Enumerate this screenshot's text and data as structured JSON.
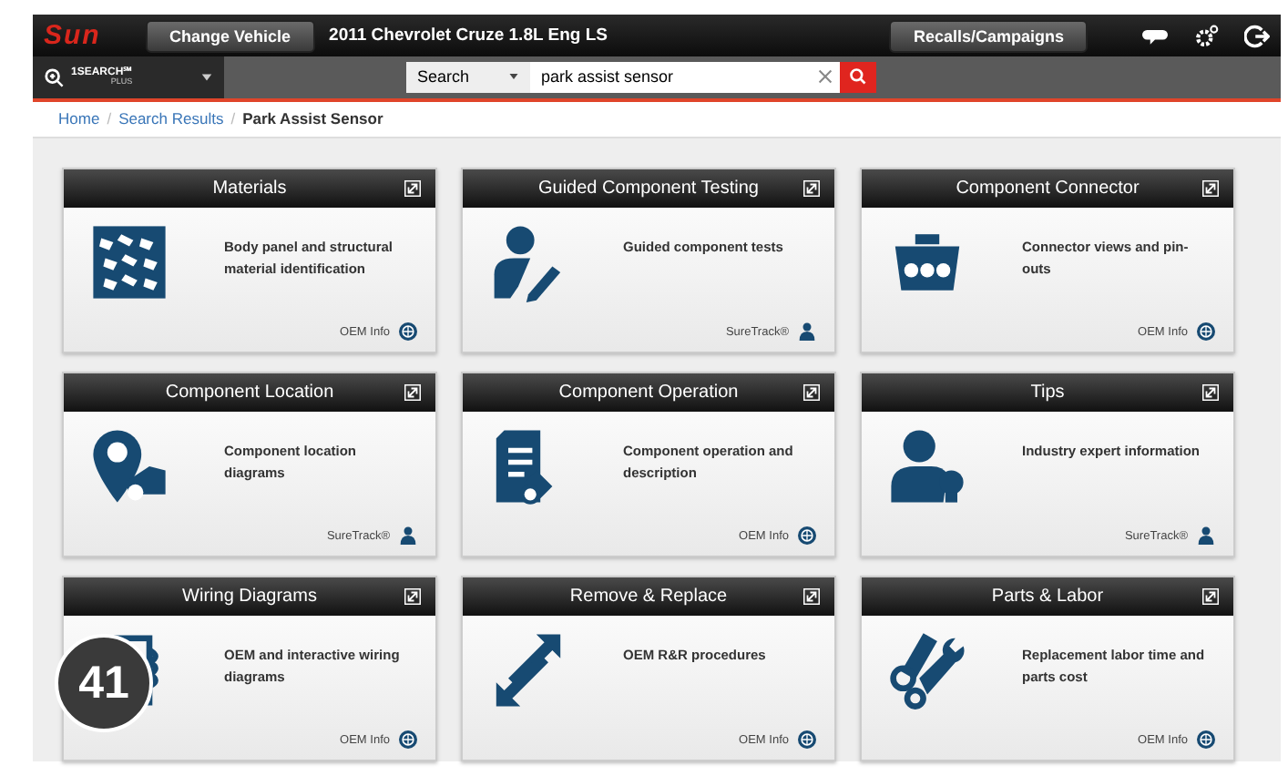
{
  "header": {
    "logo": "Sun",
    "change_vehicle": "Change Vehicle",
    "vehicle": "2011 Chevrolet Cruze 1.8L Eng LS",
    "recalls": "Recalls/Campaigns"
  },
  "search_bar": {
    "product": "1SEARCH℠",
    "product_sub": "PLUS",
    "scope": "Search",
    "value": "park assist sensor"
  },
  "breadcrumb": [
    {
      "label": "Home",
      "kind": "link"
    },
    {
      "label": "Search Results",
      "kind": "link",
      "separator": "/"
    },
    {
      "label": "Park Assist Sensor",
      "kind": "current",
      "separator": "/"
    }
  ],
  "cards": [
    {
      "title": "Materials",
      "description": "Body panel and structural material identification",
      "footer": "OEM Info",
      "kind": "oem"
    },
    {
      "title": "Guided Component Testing",
      "description": "Guided component tests",
      "footer": "SureTrack®",
      "kind": "suretrack"
    },
    {
      "title": "Component Connector",
      "description": "Connector views and pin-outs",
      "footer": "OEM Info",
      "kind": "oem"
    },
    {
      "title": "Component Location",
      "description": "Component location diagrams",
      "footer": "SureTrack®",
      "kind": "suretrack"
    },
    {
      "title": "Component Operation",
      "description": "Component operation and description",
      "footer": "OEM Info",
      "kind": "oem"
    },
    {
      "title": "Tips",
      "description": "Industry expert information",
      "footer": "SureTrack®",
      "kind": "suretrack"
    },
    {
      "title": "Wiring Diagrams",
      "description": "OEM and interactive wiring diagrams",
      "footer": "OEM Info",
      "kind": "oem"
    },
    {
      "title": "Remove & Replace",
      "description": "OEM R&R procedures",
      "footer": "OEM Info",
      "kind": "oem"
    },
    {
      "title": "Parts & Labor",
      "description": "Replacement labor time and parts cost",
      "footer": "OEM Info",
      "kind": "oem"
    }
  ],
  "badge": "41"
}
